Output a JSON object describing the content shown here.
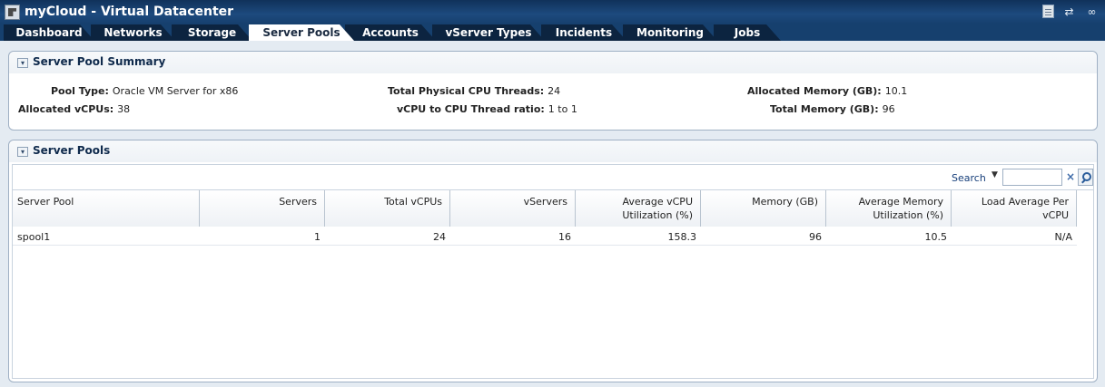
{
  "window": {
    "title": "myCloud - Virtual Datacenter",
    "icons": [
      "document-icon",
      "refresh-icon",
      "link-icon"
    ]
  },
  "tabs": [
    {
      "label": "Dashboard",
      "active": false
    },
    {
      "label": "Networks",
      "active": false
    },
    {
      "label": "Storage",
      "active": false
    },
    {
      "label": "Server Pools",
      "active": true
    },
    {
      "label": "Accounts",
      "active": false
    },
    {
      "label": "vServer Types",
      "active": false
    },
    {
      "label": "Incidents",
      "active": false
    },
    {
      "label": "Monitoring",
      "active": false
    },
    {
      "label": "Jobs",
      "active": false
    }
  ],
  "summary": {
    "title": "Server Pool Summary",
    "pool_type_label": "Pool Type:",
    "pool_type": "Oracle VM Server for x86",
    "alloc_vcpus_label": "Allocated vCPUs:",
    "alloc_vcpus": "38",
    "cpu_threads_label": "Total Physical CPU Threads:",
    "cpu_threads": "24",
    "ratio_label": "vCPU to CPU Thread ratio:",
    "ratio": "1 to 1",
    "alloc_mem_label": "Allocated Memory (GB):",
    "alloc_mem": "10.1",
    "total_mem_label": "Total Memory (GB):",
    "total_mem": "96"
  },
  "pools": {
    "title": "Server Pools",
    "search_label": "Search",
    "search_value": "",
    "columns": [
      {
        "label": "Server Pool"
      },
      {
        "label": "Servers"
      },
      {
        "label": "Total vCPUs"
      },
      {
        "label": "vServers"
      },
      {
        "label": "Average vCPU Utilization (%)"
      },
      {
        "label": "Memory (GB)"
      },
      {
        "label": "Average Memory Utilization (%)"
      },
      {
        "label": "Load Average Per vCPU"
      }
    ],
    "rows": [
      {
        "cells": [
          "spool1",
          "1",
          "24",
          "16",
          "158.3",
          "96",
          "10.5",
          "N/A"
        ]
      }
    ]
  }
}
